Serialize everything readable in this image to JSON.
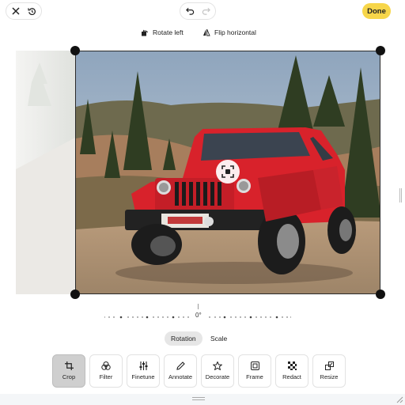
{
  "toolbar": {
    "done_label": "Done",
    "rotate_left_label": "Rotate left",
    "flip_horizontal_label": "Flip horizontal"
  },
  "ruler": {
    "value": "0°"
  },
  "tabs": [
    {
      "label": "Rotation",
      "active": true
    },
    {
      "label": "Scale",
      "active": false
    }
  ],
  "tools": [
    {
      "label": "Crop",
      "icon": "crop-icon",
      "active": true
    },
    {
      "label": "Filter",
      "icon": "filter-icon",
      "active": false
    },
    {
      "label": "Finetune",
      "icon": "sliders-icon",
      "active": false
    },
    {
      "label": "Annotate",
      "icon": "pencil-icon",
      "active": false
    },
    {
      "label": "Decorate",
      "icon": "star-icon",
      "active": false
    },
    {
      "label": "Frame",
      "icon": "frame-icon",
      "active": false
    },
    {
      "label": "Redact",
      "icon": "redact-icon",
      "active": false
    },
    {
      "label": "Resize",
      "icon": "resize-icon",
      "active": false
    }
  ],
  "colors": {
    "accent": "#f7d64a",
    "jeep": "#d8222b"
  }
}
